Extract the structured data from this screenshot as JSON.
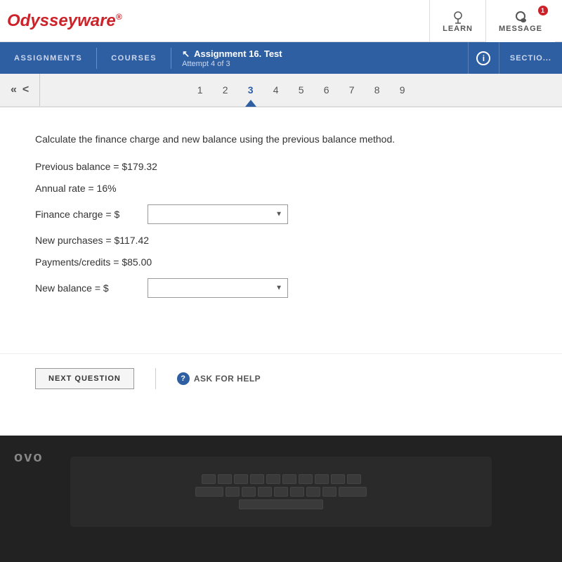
{
  "app": {
    "logo": "Odysseyware",
    "logo_sup": "®"
  },
  "top_nav": {
    "learn_label": "LEARN",
    "message_label": "MESSAGE",
    "message_badge": "1"
  },
  "secondary_nav": {
    "assignments_label": "ASSIGNMENTS",
    "courses_label": "COURSES",
    "assignment_prefix": "Assignment",
    "assignment_title": "16. Test",
    "attempt_label": "Attempt 4 of 3",
    "info_label": "i",
    "section_label": "SECTIO..."
  },
  "pagination": {
    "double_back": "«",
    "single_back": "<",
    "pages": [
      "1",
      "2",
      "3",
      "4",
      "5",
      "6",
      "7",
      "8",
      "9"
    ],
    "active_page": 3
  },
  "question": {
    "instruction": "Calculate the finance charge and new balance using the previous balance method.",
    "previous_balance_label": "Previous balance = $179.32",
    "annual_rate_label": "Annual rate = 16%",
    "finance_charge_label": "Finance charge = $",
    "finance_charge_placeholder": "",
    "new_purchases_label": "New purchases = $117.42",
    "payments_credits_label": "Payments/credits = $85.00",
    "new_balance_label": "New balance = $",
    "new_balance_placeholder": ""
  },
  "actions": {
    "next_question_label": "NEXT QUESTION",
    "ask_for_help_label": "ASK FOR HELP"
  },
  "laptop": {
    "brand": "ovo"
  }
}
